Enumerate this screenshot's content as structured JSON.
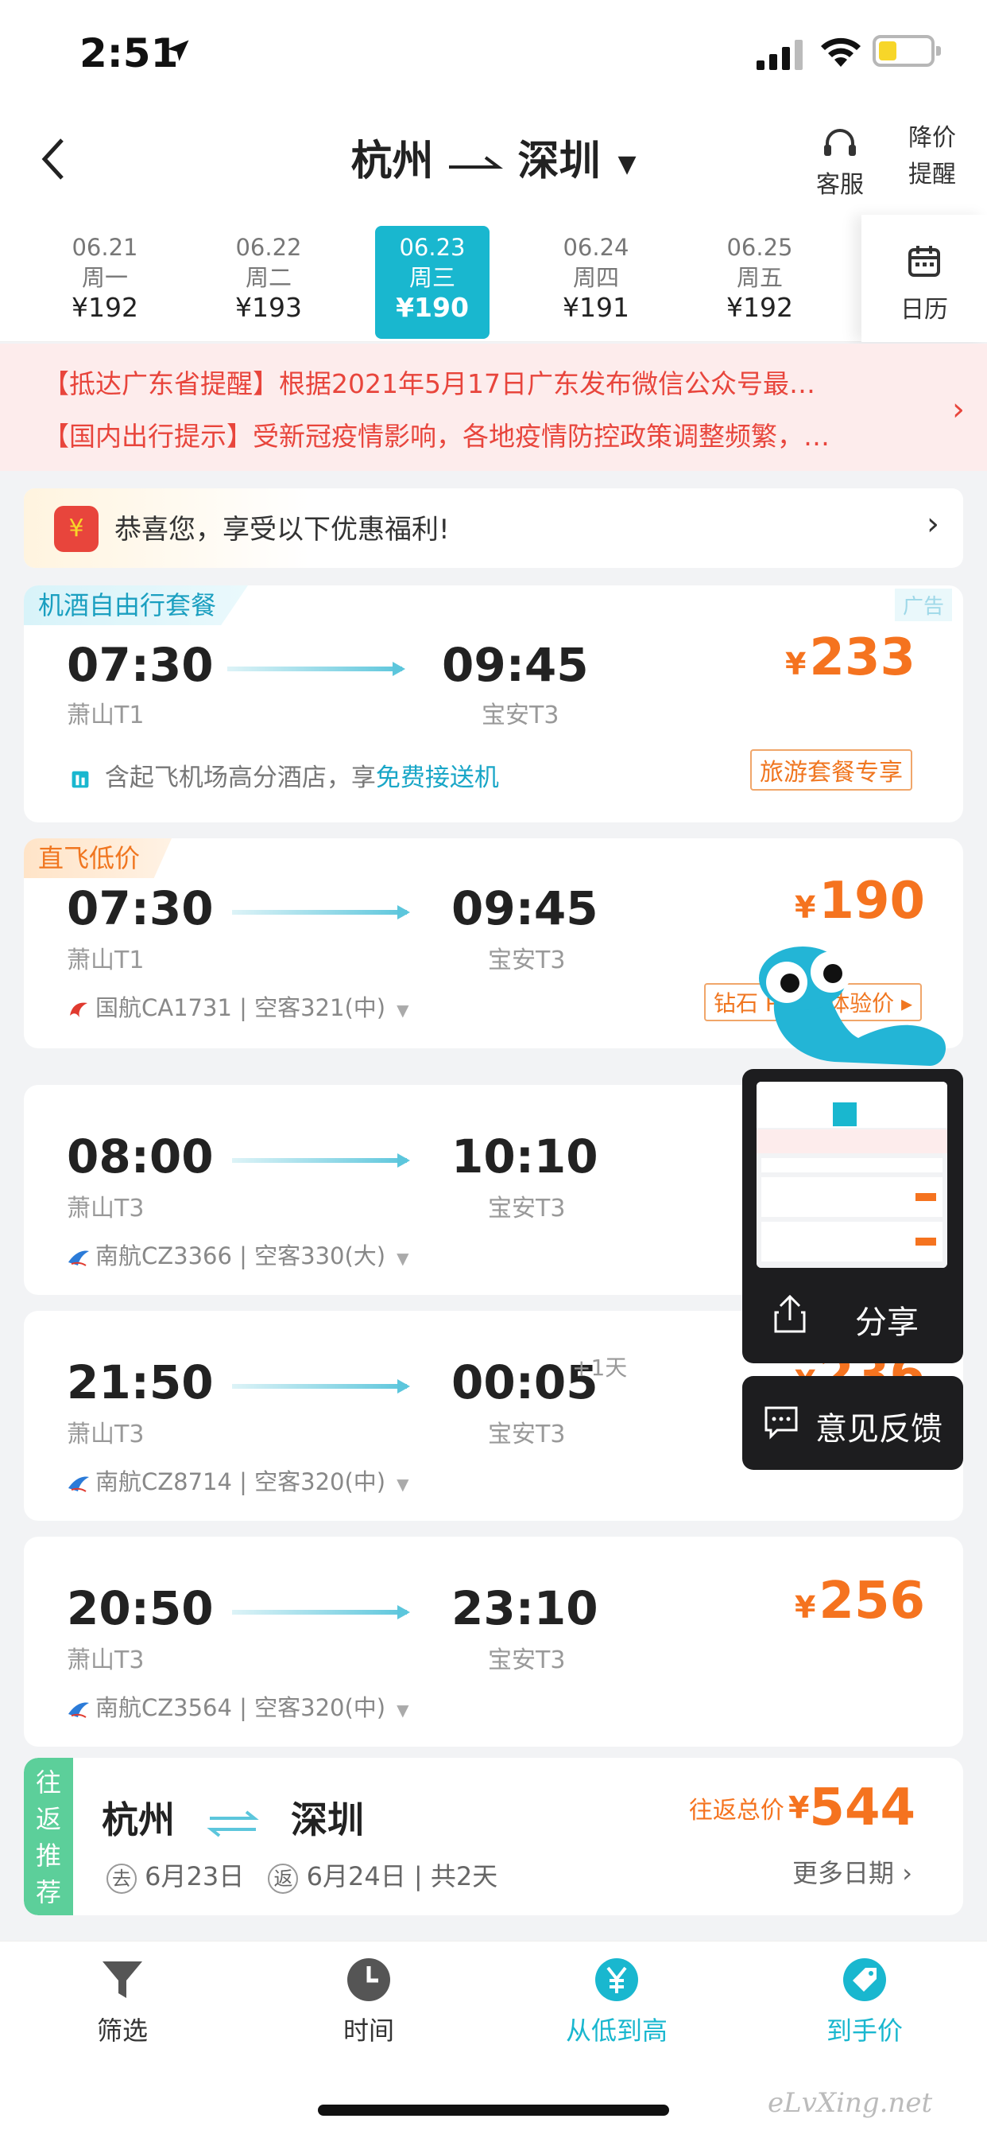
{
  "status": {
    "time": "2:51"
  },
  "nav": {
    "from": "杭州",
    "to": "深圳",
    "service_label": "客服",
    "alert_label_1": "降价",
    "alert_label_2": "提醒"
  },
  "dates": [
    {
      "date": "06.21",
      "weekday": "周一",
      "price": "¥192",
      "selected": false
    },
    {
      "date": "06.22",
      "weekday": "周二",
      "price": "¥193",
      "selected": false
    },
    {
      "date": "06.23",
      "weekday": "周三",
      "price": "¥190",
      "selected": true
    },
    {
      "date": "06.24",
      "weekday": "周四",
      "price": "¥191",
      "selected": false
    },
    {
      "date": "06.25",
      "weekday": "周五",
      "price": "¥192",
      "selected": false
    }
  ],
  "calendar_label": "日历",
  "notices": [
    "【抵达广东省提醒】根据2021年5月17日广东发布微信公众号最…",
    "【国内出行提示】受新冠疫情影响，各地疫情防控政策调整频繁，…"
  ],
  "promo": {
    "text": "恭喜您，享受以下优惠福利!",
    "icon": "¥"
  },
  "package": {
    "tag": "机酒自由行套餐",
    "ad": "广告",
    "dep_time": "07:30",
    "dep_term": "萧山T1",
    "arr_time": "09:45",
    "arr_term": "宝安T3",
    "currency": "¥",
    "price": "233",
    "hotel_prefix": "含起飞机场高分酒店，享",
    "hotel_highlight": "免费接送机",
    "button": "旅游套餐专享"
  },
  "flights": [
    {
      "tag": "直飞低价",
      "dep_time": "07:30",
      "dep_term": "萧山T1",
      "arr_time": "09:45",
      "arr_term": "宝安T3",
      "next_day": "",
      "currency": "¥",
      "price": "190",
      "airline": "国航CA1731 | 空客321(中)",
      "badge": "钻石 PLUS 体验价 ▸"
    },
    {
      "tag": "",
      "dep_time": "08:00",
      "dep_term": "萧山T3",
      "arr_time": "10:10",
      "arr_term": "宝安T3",
      "next_day": "",
      "currency": "",
      "price": "",
      "airline": "南航CZ3366 | 空客330(大)",
      "badge": ""
    },
    {
      "tag": "",
      "dep_time": "21:50",
      "dep_term": "萧山T3",
      "arr_time": "00:05",
      "arr_term": "宝安T3",
      "next_day": "+1天",
      "currency": "¥",
      "price": "236",
      "airline": "南航CZ8714 | 空客320(中)",
      "badge": ""
    },
    {
      "tag": "",
      "dep_time": "20:50",
      "dep_term": "萧山T3",
      "arr_time": "23:10",
      "arr_term": "宝安T3",
      "next_day": "",
      "currency": "¥",
      "price": "256",
      "airline": "南航CZ3564 | 空客320(中)",
      "badge": ""
    }
  ],
  "roundtrip": {
    "side": [
      "往",
      "返",
      "推",
      "荐"
    ],
    "from": "杭州",
    "to": "深圳",
    "go_label": "去",
    "go_date": "6月23日",
    "back_label": "返",
    "back_date": "6月24日",
    "total_days": "| 共2天",
    "total_label": "往返总价",
    "currency": "¥",
    "price": "544",
    "more": "更多日期 ›"
  },
  "float_menu": {
    "share": "分享",
    "feedback": "意见反馈"
  },
  "tabs": [
    {
      "label": "筛选",
      "icon": "filter-icon",
      "active": false
    },
    {
      "label": "时间",
      "icon": "clock-icon",
      "active": false
    },
    {
      "label": "从低到高",
      "icon": "yen-icon",
      "active": true
    },
    {
      "label": "到手价",
      "icon": "tag-icon",
      "active": true
    }
  ],
  "watermark": "eLvXing.net",
  "colors": {
    "accent": "#19b7cf",
    "price": "#f5731f",
    "notice": "#e8453c",
    "roundtrip": "#5ccf9a"
  }
}
